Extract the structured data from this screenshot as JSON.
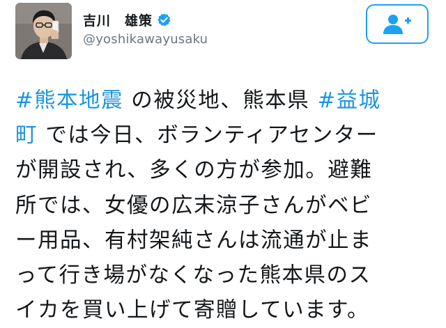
{
  "user": {
    "display_name": "吉川　雄策",
    "handle": "@yoshikawayusaku",
    "verified": true
  },
  "follow_button": {
    "icon": "add-user-icon",
    "color": "#1da1f2"
  },
  "tweet": {
    "lines": [
      [
        {
          "text": "#熊本地震",
          "type": "hashtag"
        },
        {
          "text": " の被災地、熊本県 ",
          "type": "text"
        },
        {
          "text": "#益城",
          "type": "hashtag"
        }
      ],
      [
        {
          "text": "町",
          "type": "hashtag"
        },
        {
          "text": " では今日、ボランティアセンター",
          "type": "text"
        }
      ],
      [
        {
          "text": "が開設され、多くの方が参加。避難",
          "type": "text"
        }
      ],
      [
        {
          "text": "所では、女優の広末涼子さんがベビ",
          "type": "text"
        }
      ],
      [
        {
          "text": "ー用品、有村架純さんは流通が止ま",
          "type": "text"
        }
      ],
      [
        {
          "text": "って行き場がなくなった熊本県のス",
          "type": "text"
        }
      ],
      [
        {
          "text": "イカを買い上げて寄贈しています。",
          "type": "text"
        }
      ]
    ]
  },
  "colors": {
    "hashtag": "#1b95e0",
    "text": "#14171a",
    "handle": "#657786",
    "verified_badge": "#1da1f2"
  }
}
